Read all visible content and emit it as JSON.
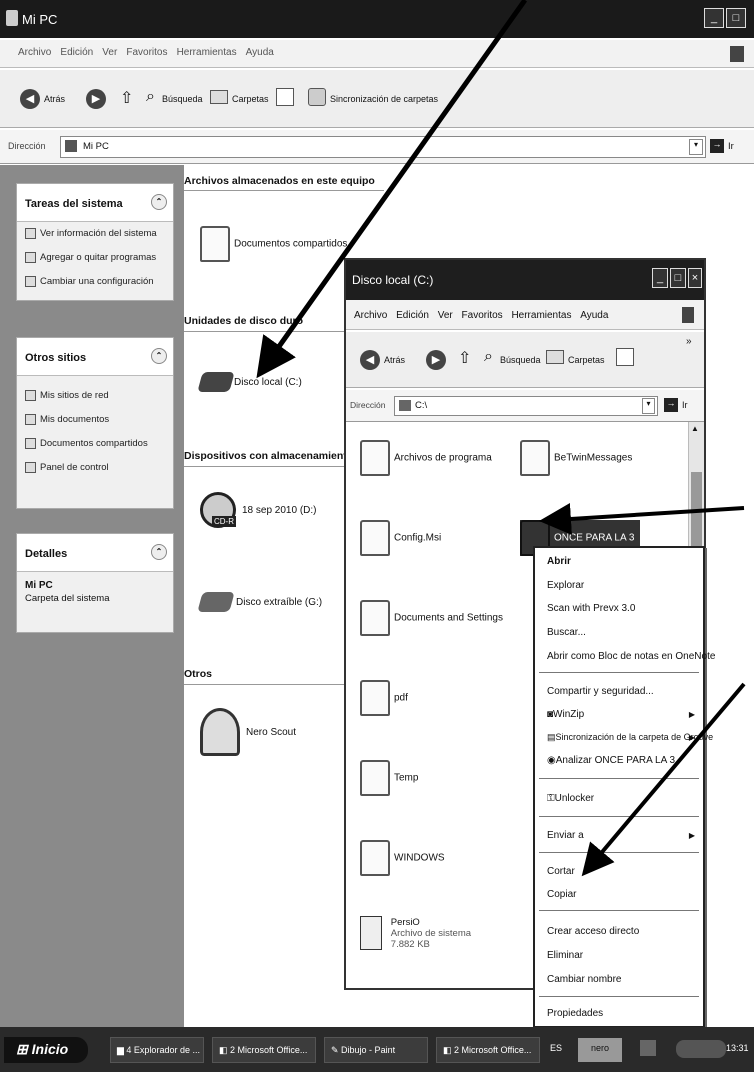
{
  "window": {
    "title": "Mi PC",
    "menu": [
      "Archivo",
      "Edición",
      "Ver",
      "Favoritos",
      "Herramientas",
      "Ayuda"
    ],
    "toolbar": {
      "back": "Atrás",
      "search": "Búsqueda",
      "folders": "Carpetas",
      "sync": "Sincronización de carpetas"
    },
    "address": {
      "label": "Dirección",
      "value": "Mi PC",
      "go": "Ir"
    }
  },
  "left_panels": [
    {
      "title": "Tareas del sistema",
      "items": [
        "Ver información del sistema",
        "Agregar o quitar programas",
        "Cambiar una configuración"
      ]
    },
    {
      "title": "Otros sitios",
      "items": [
        "Mis sitios de red",
        "Mis documentos",
        "Documentos compartidos",
        "Panel de control"
      ]
    },
    {
      "title": "Detalles",
      "items": [
        "Mi PC",
        "Carpeta del sistema"
      ]
    }
  ],
  "main": {
    "sections": {
      "stored": "Archivos almacenados en este equipo",
      "drives": "Unidades de disco duro",
      "removable": "Dispositivos con almacenamiento ext",
      "other": "Otros"
    },
    "items": {
      "shared_docs": "Documentos compartidos",
      "local_disk": "Disco local (C:)",
      "cd": "18 sep 2010 (D:)",
      "cd_badge": "CD-R",
      "removable_disk": "Disco extraíble (G:)",
      "nero": "Nero Scout"
    }
  },
  "inner_window": {
    "title": "Disco local (C:)",
    "menu": [
      "Archivo",
      "Edición",
      "Ver",
      "Favoritos",
      "Herramientas",
      "Ayuda"
    ],
    "toolbar": {
      "back": "Atrás",
      "search": "Búsqueda",
      "folders": "Carpetas"
    },
    "address": {
      "label": "Dirección",
      "value": "C:\\",
      "go": "Ir"
    },
    "files_left": [
      "Archivos de programa",
      "Config.Msi",
      "Documents and Settings",
      "pdf",
      "Temp",
      "WINDOWS"
    ],
    "files_right": [
      "BeTwinMessages",
      "ONCE PARA LA 3"
    ],
    "sysfile": {
      "name": "PersiO",
      "type": "Archivo de sistema",
      "size": "7.882 KB"
    }
  },
  "context_menu": {
    "items": [
      "Abrir",
      "Explorar",
      "Scan with Prevx 3.0",
      "Buscar...",
      "Abrir como Bloc de notas en OneNote",
      "Compartir y seguridad...",
      "WinZip",
      "Sincronización de la carpeta de Groove",
      "Analizar ONCE PARA LA 3",
      "Unlocker",
      "Enviar a",
      "Cortar",
      "Copiar",
      "Crear acceso directo",
      "Eliminar",
      "Cambiar nombre",
      "Propiedades"
    ]
  },
  "taskbar": {
    "start": "Inicio",
    "tasks": [
      "4 Explorador de ...",
      "2 Microsoft Office...",
      "Dibujo - Paint",
      "2 Microsoft Office..."
    ],
    "lang": "ES",
    "nero": "nero",
    "clock": "13:31"
  }
}
